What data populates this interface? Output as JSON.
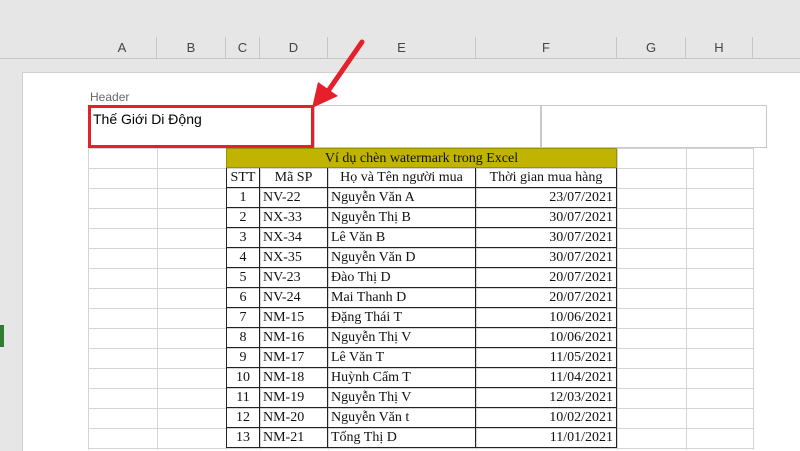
{
  "columns": [
    "A",
    "B",
    "C",
    "D",
    "E",
    "F",
    "G",
    "H"
  ],
  "header": {
    "label": "Header",
    "left_text": "Thế Giới Di Động"
  },
  "table": {
    "title": "Ví dụ chèn watermark trong Excel",
    "headers": [
      "STT",
      "Mã SP",
      "Họ và Tên người mua",
      "Thời gian mua hàng"
    ],
    "rows": [
      [
        "1",
        "NV-22",
        "Nguyễn Văn A",
        "23/07/2021"
      ],
      [
        "2",
        "NX-33",
        "Nguyễn Thị B",
        "30/07/2021"
      ],
      [
        "3",
        "NX-34",
        "Lê Văn B",
        "30/07/2021"
      ],
      [
        "4",
        "NX-35",
        "Nguyễn Văn D",
        "30/07/2021"
      ],
      [
        "5",
        "NV-23",
        "Đào Thị D",
        "20/07/2021"
      ],
      [
        "6",
        "NV-24",
        "Mai Thanh D",
        "20/07/2021"
      ],
      [
        "7",
        "NM-15",
        "Đặng Thái T",
        "10/06/2021"
      ],
      [
        "8",
        "NM-16",
        "Nguyễn Thị V",
        "10/06/2021"
      ],
      [
        "9",
        "NM-17",
        "Lê Văn T",
        "11/05/2021"
      ],
      [
        "10",
        "NM-18",
        "Huỳnh Cẩm T",
        "11/04/2021"
      ],
      [
        "11",
        "NM-19",
        "Nguyễn Thị V",
        "12/03/2021"
      ],
      [
        "12",
        "NM-20",
        "Nguyễn Văn t",
        "10/02/2021"
      ],
      [
        "13",
        "NM-21",
        "Tống Thị D",
        "11/01/2021"
      ]
    ]
  },
  "colors": {
    "title_fill": "#c0b400",
    "highlight": "#e5202a"
  },
  "icons": [
    "red-arrow-icon"
  ]
}
